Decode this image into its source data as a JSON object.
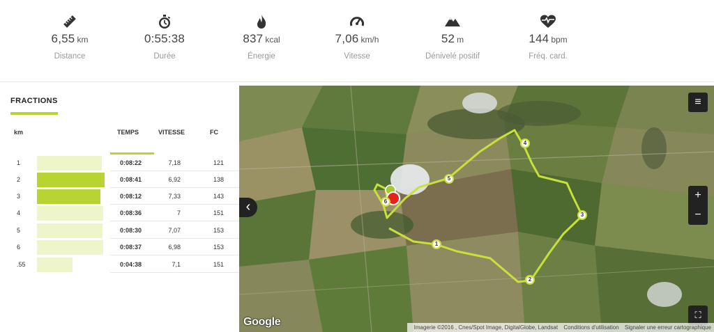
{
  "stats": [
    {
      "icon": "ruler-icon",
      "value": "6,55",
      "unit": "km",
      "label": "Distance"
    },
    {
      "icon": "stopwatch-icon",
      "value": "0:55:38",
      "unit": "",
      "label": "Durée"
    },
    {
      "icon": "flame-icon",
      "value": "837",
      "unit": "kcal",
      "label": "Énergie"
    },
    {
      "icon": "speedometer-icon",
      "value": "7,06",
      "unit": "km/h",
      "label": "Vitesse"
    },
    {
      "icon": "mountain-icon",
      "value": "52",
      "unit": "m",
      "label": "Dénivelé positif"
    },
    {
      "icon": "heart-rate-icon",
      "value": "144",
      "unit": "bpm",
      "label": "Fréq. card."
    }
  ],
  "fractions": {
    "title": "FRACTIONS",
    "headers": {
      "km": "km",
      "time": "TEMPS",
      "speed": "VITESSE",
      "hr": "FC"
    },
    "rows": [
      {
        "km": "1",
        "time": "0:08:22",
        "speed": "7,18",
        "hr": "121",
        "highlight": false,
        "bar_fraction": 0.93
      },
      {
        "km": "2",
        "time": "0:08:41",
        "speed": "6,92",
        "hr": "138",
        "highlight": true,
        "bar_fraction": 0.97
      },
      {
        "km": "3",
        "time": "0:08:12",
        "speed": "7,33",
        "hr": "143",
        "highlight": true,
        "bar_fraction": 0.91
      },
      {
        "km": "4",
        "time": "0:08:36",
        "speed": "7",
        "hr": "151",
        "highlight": false,
        "bar_fraction": 0.95
      },
      {
        "km": "5",
        "time": "0:08:30",
        "speed": "7,07",
        "hr": "153",
        "highlight": false,
        "bar_fraction": 0.94
      },
      {
        "km": "6",
        "time": "0:08:37",
        "speed": "6,98",
        "hr": "153",
        "highlight": false,
        "bar_fraction": 0.95
      },
      {
        "km": ".55",
        "time": "0:04:38",
        "speed": "7,1",
        "hr": "151",
        "highlight": false,
        "bar_fraction": 0.51
      }
    ]
  },
  "map": {
    "markers": [
      "1",
      "2",
      "3",
      "4",
      "5",
      "6"
    ],
    "nav_left": "‹",
    "menu": "≡",
    "zoom_in": "+",
    "zoom_out": "−",
    "fullscreen": "⛶",
    "google_logo": "Google",
    "attribution": "Imagerie ©2016 , Cnes/Spot Image, DigitalGlobe, Landsat",
    "terms": "Conditions d'utilisation",
    "report": "Signaler une erreur cartographique"
  },
  "colors": {
    "accent": "#b8d433",
    "bar_light": "#eef5c8",
    "route": "#c8e03a",
    "end_marker": "#e8221a"
  }
}
